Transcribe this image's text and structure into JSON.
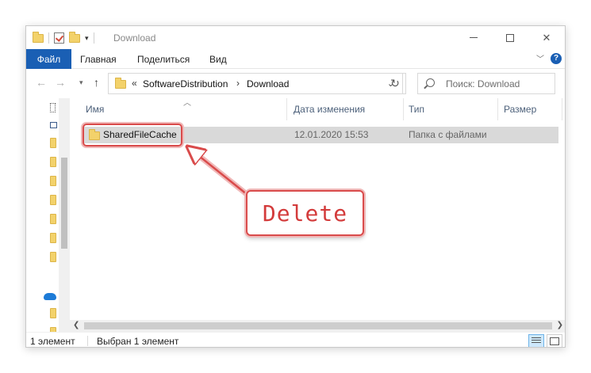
{
  "window": {
    "title": "Download",
    "minimize_label": "",
    "maximize_label": "",
    "close_label": "✕"
  },
  "ribbon": {
    "file_tab": "Файл",
    "tabs": [
      "Главная",
      "Поделиться",
      "Вид"
    ],
    "help_label": "?"
  },
  "address": {
    "back_icon": "back-arrow-icon",
    "forward_icon": "forward-arrow-icon",
    "overflow_marker": "«",
    "crumbs": [
      "SoftwareDistribution",
      "Download"
    ],
    "separator": "›"
  },
  "search": {
    "placeholder": "Поиск: Download"
  },
  "columns": {
    "name": "Имя",
    "date": "Дата изменения",
    "type": "Тип",
    "size": "Размер"
  },
  "files": [
    {
      "name": "SharedFileCache",
      "date": "12.01.2020 15:53",
      "type": "Папка с файлами",
      "size": ""
    }
  ],
  "status": {
    "count": "1 элемент",
    "selection": "Выбран 1 элемент"
  },
  "annotation": {
    "text": "Delete",
    "color": "#d33b3b"
  },
  "colors": {
    "accent": "#1a5fb4",
    "selection_row": "#d9d9d9",
    "folder": "#f3d26b"
  }
}
